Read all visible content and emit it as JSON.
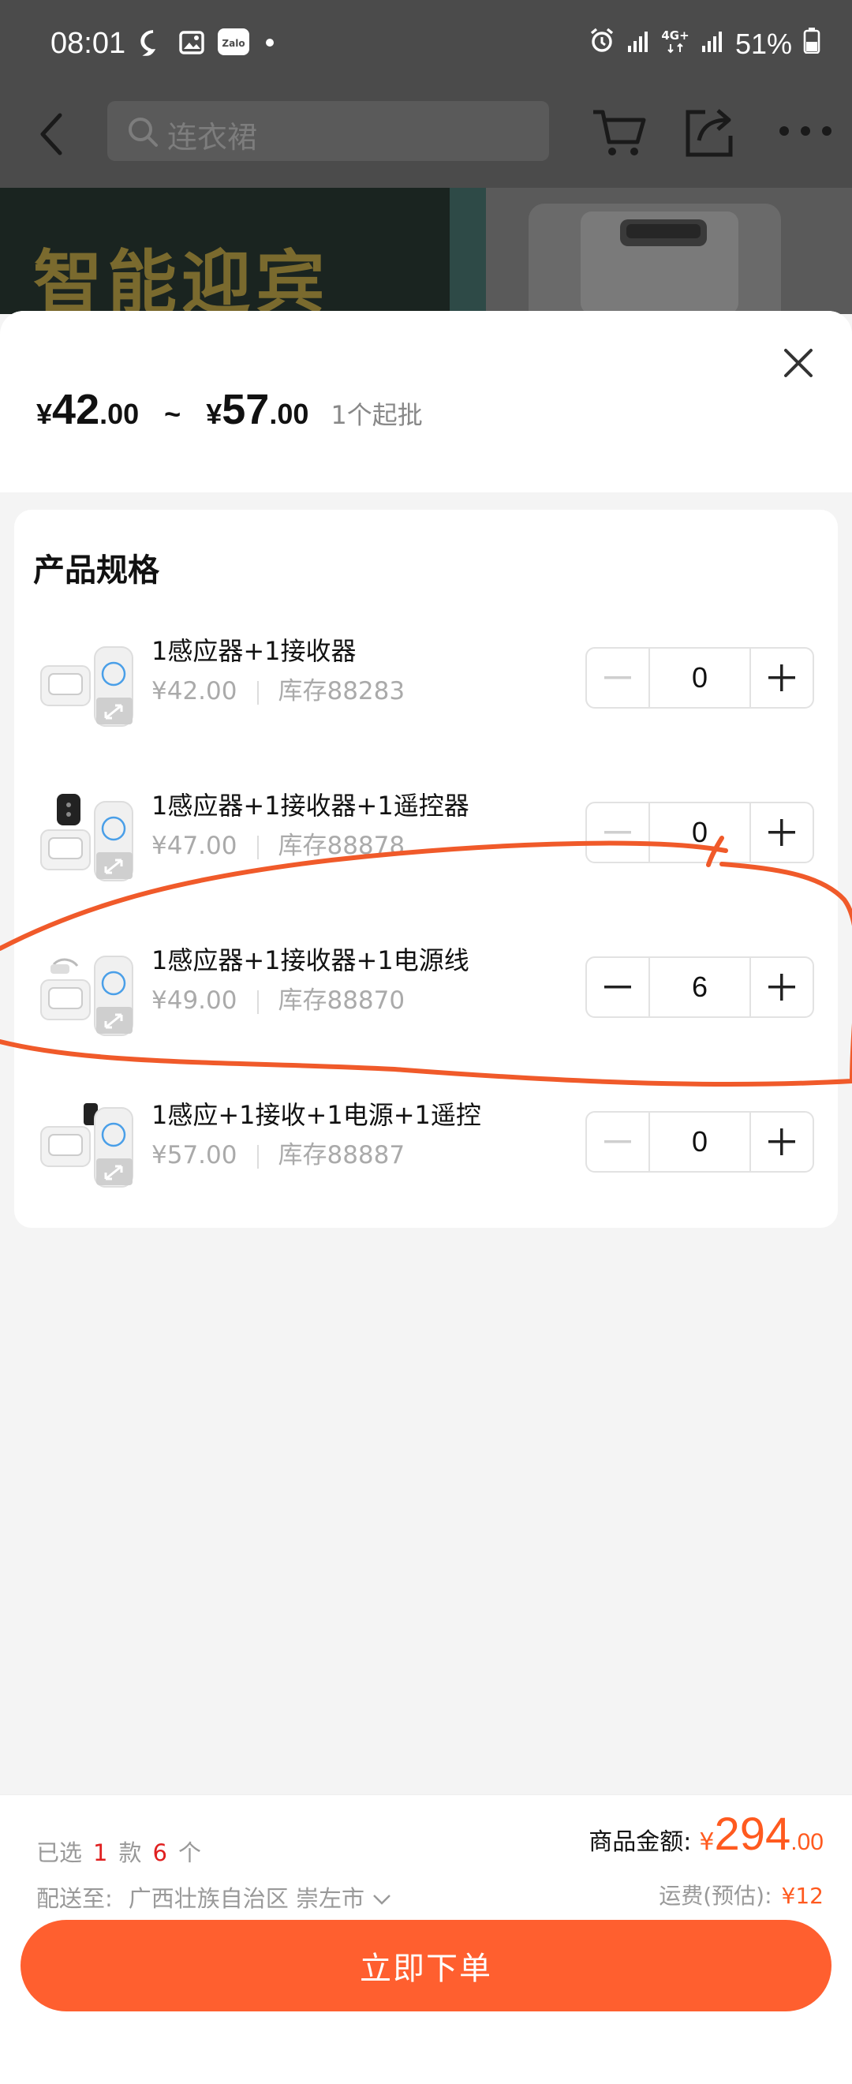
{
  "status_bar": {
    "time": "08:01",
    "battery": "51%",
    "left_icons": [
      "chat-bubble-icon",
      "gallery-icon",
      "zalo-icon",
      "dot-icon"
    ],
    "right_icons": [
      "alarm-icon",
      "signal-icon",
      "4g-icon",
      "signal-icon",
      "battery-icon"
    ]
  },
  "top_nav": {
    "search_placeholder": "连衣裙"
  },
  "banner": {
    "title": "智能迎宾"
  },
  "sheet": {
    "price": {
      "currency": "¥",
      "min_int": "42",
      "min_dec": ".00",
      "range_sep": "~",
      "max_int": "57",
      "max_dec": ".00",
      "moq": "1个起批"
    },
    "section_title": "产品规格",
    "items": [
      {
        "name": "1感应器+1接收器",
        "price": "¥42.00",
        "stock": "库存88283",
        "qty": "0"
      },
      {
        "name": "1感应器+1接收器+1遥控器",
        "price": "¥47.00",
        "stock": "库存88878",
        "qty": "0"
      },
      {
        "name": "1感应器+1接收器+1电源线",
        "price": "¥49.00",
        "stock": "库存88870",
        "qty": "6"
      },
      {
        "name": "1感应+1接收+1电源+1遥控",
        "price": "¥57.00",
        "stock": "库存88887",
        "qty": "0"
      }
    ]
  },
  "footer": {
    "selected_prefix": "已选",
    "selected_kinds": "1",
    "kinds_unit": "款",
    "selected_count": "6",
    "count_unit": "个",
    "ship_label": "配送至:",
    "ship_address": "广西壮族自治区 崇左市",
    "amount_label": "商品金额:",
    "amount_currency": "¥",
    "amount_int": "294",
    "amount_dec": ".00",
    "freight_label": "运费(预估):",
    "freight_value": "¥12",
    "buy_button": "立即下单"
  },
  "colors": {
    "accent": "#ff5f2f",
    "annotation_stroke": "#f05a2a",
    "highlight_red": "#e02020"
  }
}
